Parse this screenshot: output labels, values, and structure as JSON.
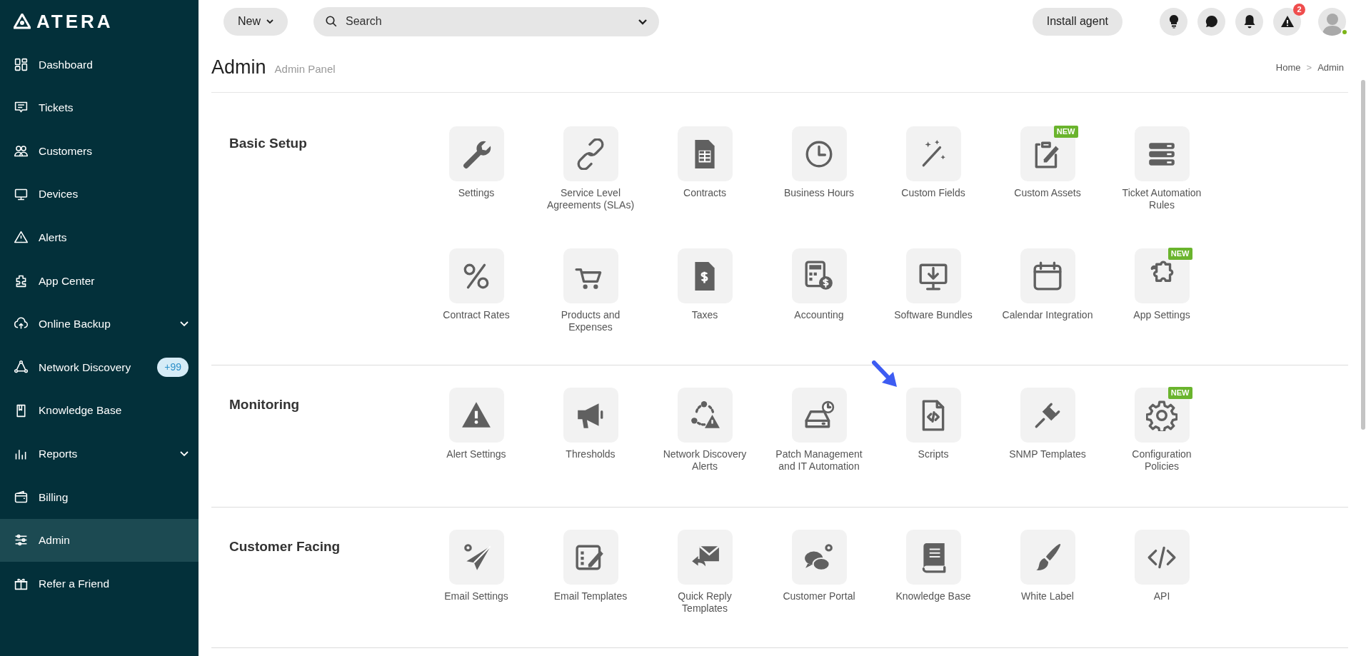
{
  "sidebar": {
    "logo": "ATERA",
    "items": [
      {
        "label": "Dashboard",
        "selected": false
      },
      {
        "label": "Tickets",
        "selected": false
      },
      {
        "label": "Customers",
        "selected": false
      },
      {
        "label": "Devices",
        "selected": false
      },
      {
        "label": "Alerts",
        "selected": false
      },
      {
        "label": "App Center",
        "selected": false
      },
      {
        "label": "Online Backup",
        "selected": false,
        "expanded": false
      },
      {
        "label": "Network Discovery",
        "selected": false,
        "badge": "+99"
      },
      {
        "label": "Knowledge Base",
        "selected": false
      },
      {
        "label": "Reports",
        "selected": false,
        "expanded": false
      },
      {
        "label": "Billing",
        "selected": false
      },
      {
        "label": "Admin",
        "selected": true
      },
      {
        "label": "Refer a Friend",
        "selected": false
      }
    ]
  },
  "topbar": {
    "new_button": "New",
    "search": {
      "placeholder": "Search"
    },
    "install_button": "Install agent",
    "alerts_count": "2",
    "user_online": true
  },
  "page": {
    "title": "Admin",
    "subtitle": "Admin Panel",
    "breadcrumb": [
      "Home",
      ">",
      "Admin"
    ]
  },
  "sections": [
    {
      "title": "Basic Setup",
      "items": [
        {
          "label": "Settings"
        },
        {
          "label": "Service Level Agreements (SLAs)"
        },
        {
          "label": "Contracts"
        },
        {
          "label": "Business Hours"
        },
        {
          "label": "Custom Fields"
        },
        {
          "label": "Custom Assets",
          "badge": "NEW"
        },
        {
          "label": "Ticket Automation Rules"
        },
        {
          "label": "Contract Rates"
        },
        {
          "label": "Products and Expenses"
        },
        {
          "label": "Taxes"
        },
        {
          "label": "Accounting"
        },
        {
          "label": "Software Bundles"
        },
        {
          "label": "Calendar Integration"
        },
        {
          "label": "App Settings",
          "badge": "NEW"
        }
      ]
    },
    {
      "title": "Monitoring",
      "items": [
        {
          "label": "Alert Settings"
        },
        {
          "label": "Thresholds"
        },
        {
          "label": "Network Discovery Alerts"
        },
        {
          "label": "Patch Management and IT Automation"
        },
        {
          "label": "Scripts"
        },
        {
          "label": "SNMP Templates"
        },
        {
          "label": "Configuration Policies",
          "badge": "NEW"
        }
      ]
    },
    {
      "title": "Customer Facing",
      "items": [
        {
          "label": "Email Settings"
        },
        {
          "label": "Email Templates"
        },
        {
          "label": "Quick Reply Templates"
        },
        {
          "label": "Customer Portal"
        },
        {
          "label": "Knowledge Base"
        },
        {
          "label": "White Label"
        },
        {
          "label": "API"
        }
      ]
    }
  ]
}
